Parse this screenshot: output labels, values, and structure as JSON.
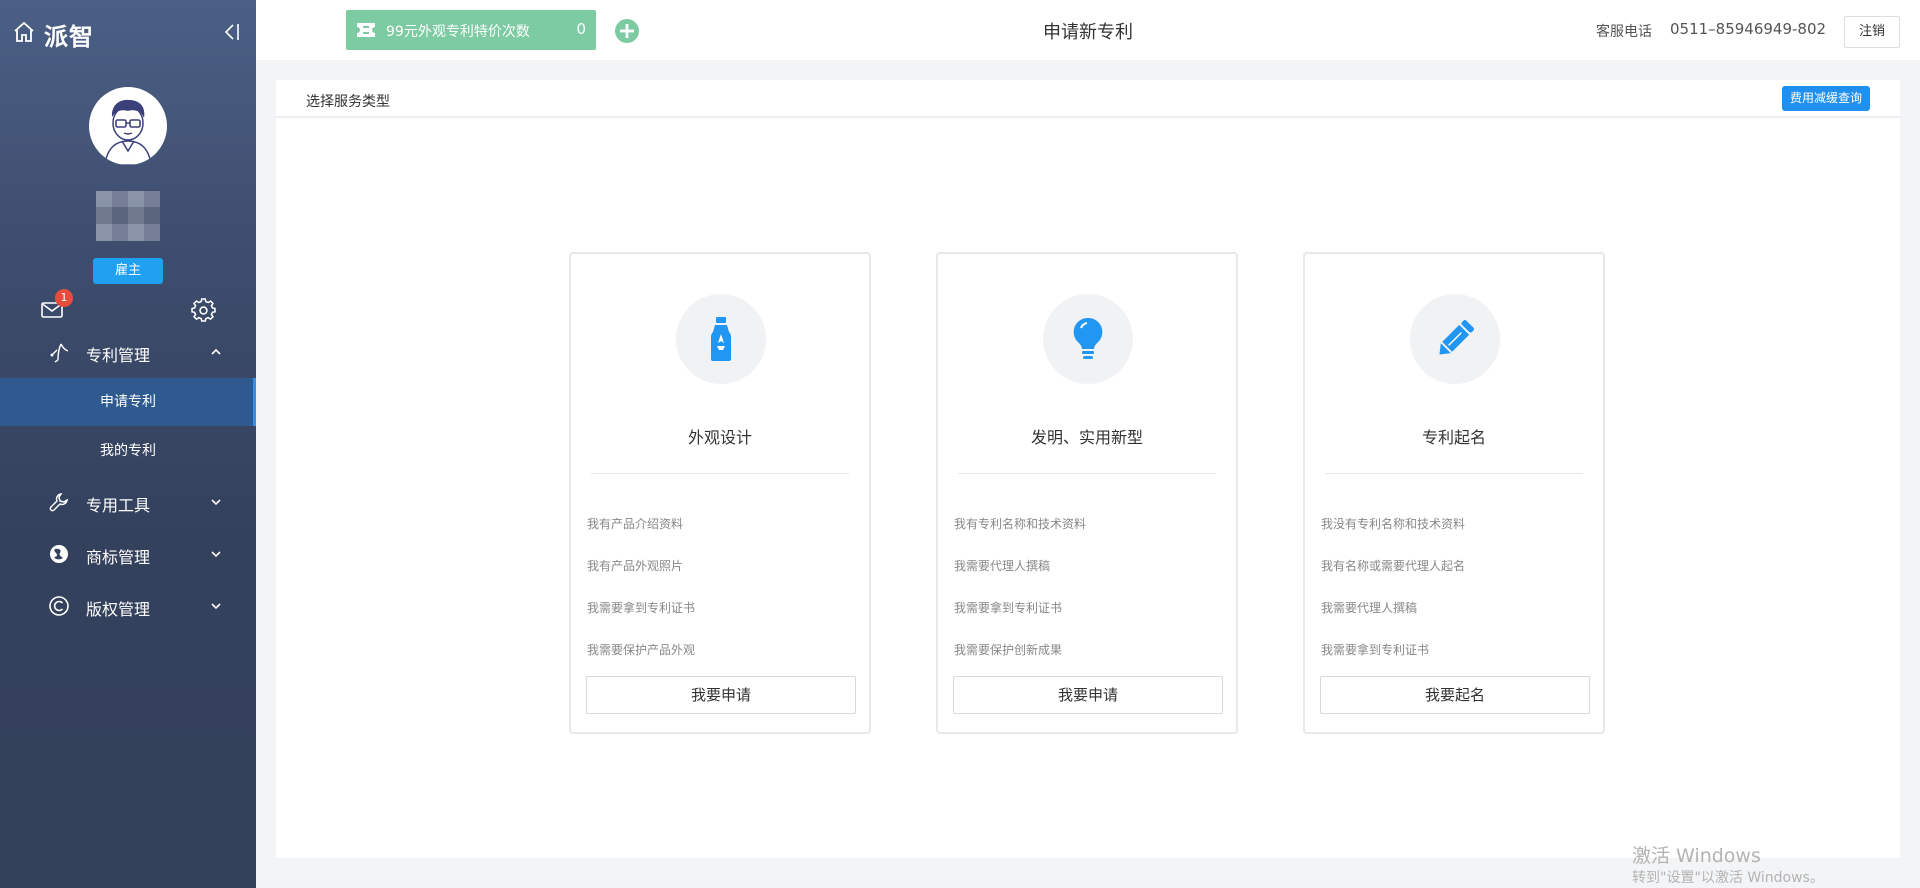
{
  "sidebar": {
    "logo_text": "派智",
    "role_badge": "雇主",
    "mail_count": "1",
    "menu": [
      {
        "label": "专利管理",
        "icon": "patent-icon",
        "expanded": true
      },
      {
        "label": "专用工具",
        "icon": "wrench-icon",
        "expanded": false
      },
      {
        "label": "商标管理",
        "icon": "trademark-icon",
        "expanded": false
      },
      {
        "label": "版权管理",
        "icon": "copyright-icon",
        "expanded": false
      }
    ],
    "submenu": [
      {
        "label": "申请专利",
        "active": true
      },
      {
        "label": "我的专利",
        "active": false
      }
    ]
  },
  "topbar": {
    "promo_label": "99元外观专利特价次数",
    "promo_count": "0",
    "page_title": "申请新专利",
    "hotline_label": "客服电话",
    "hotline_number": "0511–85946949-802",
    "logout_label": "注销"
  },
  "main": {
    "section_title": "选择服务类型",
    "fee_button": "费用减缓查询",
    "cards": [
      {
        "title": "外观设计",
        "icon": "bottle-icon",
        "features": [
          "我有产品介绍资料",
          "我有产品外观照片",
          "我需要拿到专利证书",
          "我需要保护产品外观"
        ],
        "button": "我要申请"
      },
      {
        "title": "发明、实用新型",
        "icon": "lightbulb-icon",
        "features": [
          "我有专利名称和技术资料",
          "我需要代理人撰稿",
          "我需要拿到专利证书",
          "我需要保护创新成果"
        ],
        "button": "我要申请"
      },
      {
        "title": "专利起名",
        "icon": "pencil-icon",
        "features": [
          "我没有专利名称和技术资料",
          "我有名称或需要代理人起名",
          "我需要代理人撰稿",
          "我需要拿到专利证书"
        ],
        "button": "我要起名"
      }
    ]
  },
  "watermark": {
    "line1": "激活 Windows",
    "line2": "转到\"设置\"以激活 Windows。"
  },
  "colors": {
    "sidebar_top": "#4b5f85",
    "sidebar_bottom": "#334059",
    "active_item": "#2f5a8f",
    "accent_blue": "#1f8ff0",
    "promo_green": "#7dcba2",
    "icon_blue": "#2196f3"
  }
}
